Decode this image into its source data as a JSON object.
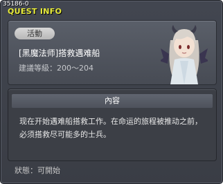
{
  "quest_id": "35186-0",
  "window_title": "QUEST INFO",
  "category_label": "活動",
  "quest_name": "[黑魔法师]搭救遇难船",
  "required_level": "建議等級：200～204",
  "content_header": "內容",
  "content_text": "现在开始遇难船搭救工作。在命运的旅程被推动之前，必须搭救尽可能多的士兵。",
  "status": "狀態：可開始",
  "icons": {
    "npc": "npc-portrait-icon"
  },
  "colors": {
    "title": "#e8ec3a",
    "panel": "#4b4f58",
    "background": "#3e4149"
  }
}
